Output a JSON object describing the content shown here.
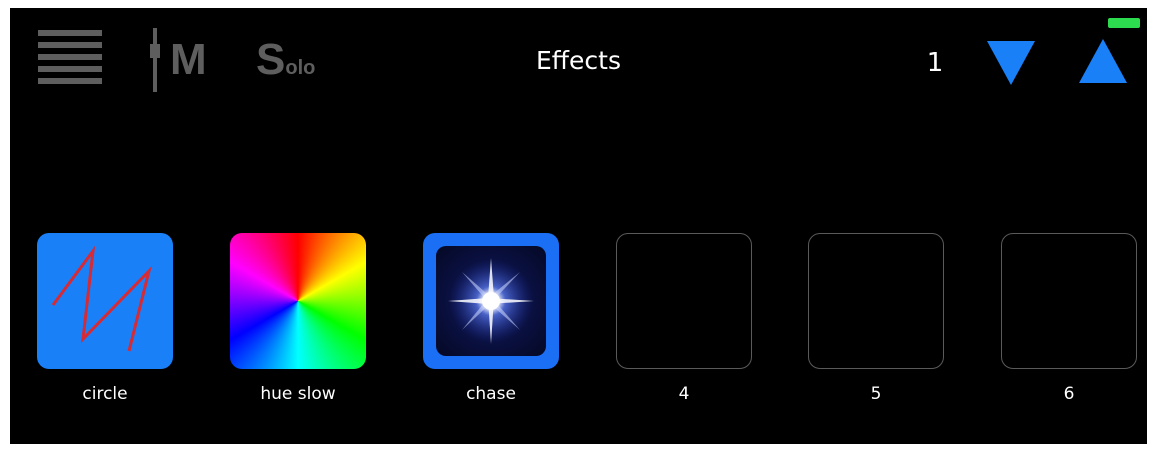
{
  "header": {
    "title": "Effects",
    "mixer_letter": "M",
    "solo_initial": "S",
    "solo_rest": "olo",
    "page_number": "1"
  },
  "colors": {
    "accent": "#1a80f8",
    "icon_gray": "#5e5e5e",
    "battery": "#2ddc4e",
    "slot_border": "#5a5a5a"
  },
  "icons": {
    "menu": "menu-icon",
    "mixer": "fader-icon",
    "page_down": "triangle-down-icon",
    "page_up": "triangle-up-icon",
    "battery": "battery-icon"
  },
  "effects": [
    {
      "label": "circle",
      "icon": "zigzag-icon"
    },
    {
      "label": "hue slow",
      "icon": "color-wheel-icon"
    },
    {
      "label": "chase",
      "icon": "star-burst-icon"
    },
    {
      "label": "4"
    },
    {
      "label": "5"
    },
    {
      "label": "6"
    }
  ]
}
